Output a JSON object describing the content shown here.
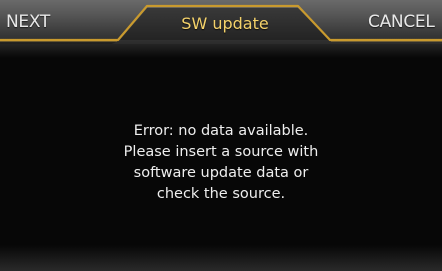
{
  "header": {
    "next_label": "NEXT",
    "title": "SW update",
    "cancel_label": "CANCEL"
  },
  "message": {
    "lines": [
      "Error: no data available.",
      "Please insert a source with",
      "software update data or",
      "check the source."
    ]
  },
  "colors": {
    "title": "#f4d26a",
    "tab_outline": "#c99a2e",
    "text": "#eeeeee",
    "background": "#070707"
  }
}
